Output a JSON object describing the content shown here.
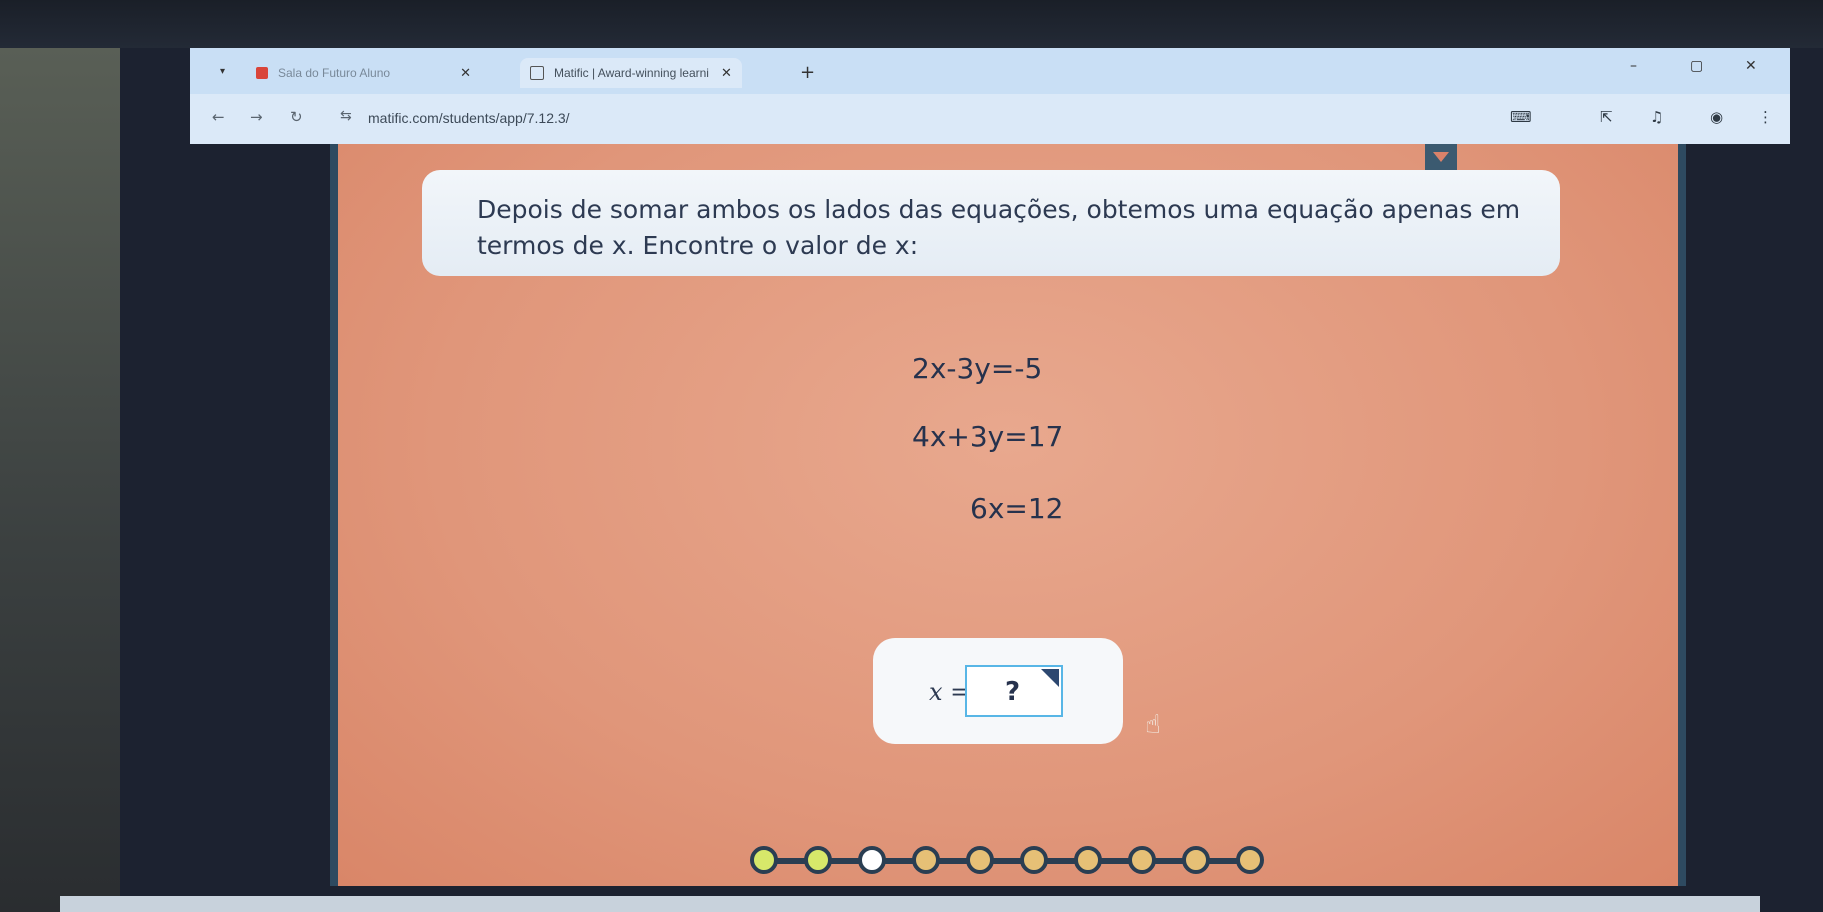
{
  "browser": {
    "tabs": [
      {
        "label": "Sala do Futuro Aluno",
        "active": false,
        "favicon_color": "#d9453a"
      },
      {
        "label": "Matific | Award-winning learni",
        "active": true,
        "favicon_color": "#555555"
      }
    ],
    "url": "matific.com/students/app/7.12.3/",
    "icons": {
      "tab_list": "chevron-down-icon",
      "close": "close-icon",
      "new_tab": "plus-icon",
      "back": "back-arrow-icon",
      "forward": "forward-arrow-icon",
      "reload": "reload-icon",
      "site_info": "tune-icon",
      "translate": "translate-icon",
      "share": "share-icon",
      "media": "media-icon",
      "profile": "profile-icon",
      "menu": "more-vertical-icon"
    }
  },
  "question": {
    "text": "Depois de somar ambos os lados das equações, obtemos uma equação apenas em termos de x. Encontre o valor de x:"
  },
  "equations": [
    "2x-3y=-5",
    "4x+3y=17",
    "6x=12"
  ],
  "answer": {
    "label": "x =",
    "placeholder": "?"
  },
  "progress": {
    "total": 10,
    "completed": 2,
    "current": 3,
    "colors": {
      "completed": "#d7e86a",
      "current": "#ffffff",
      "upcoming": "#e6c076"
    }
  }
}
